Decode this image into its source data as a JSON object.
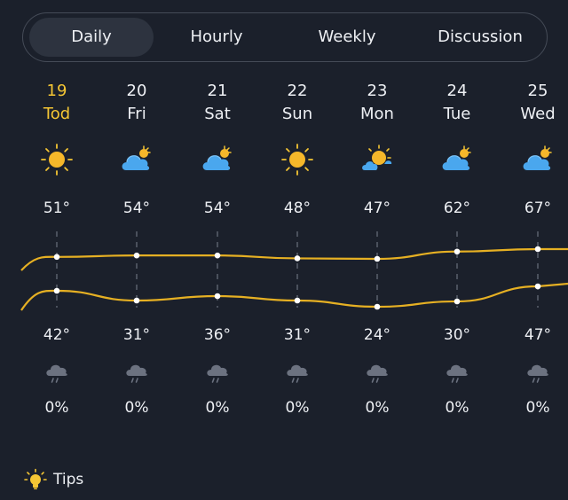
{
  "tabs": [
    {
      "label": "Daily",
      "active": true
    },
    {
      "label": "Hourly",
      "active": false
    },
    {
      "label": "Weekly",
      "active": false
    },
    {
      "label": "Discussion",
      "active": false
    }
  ],
  "days": [
    {
      "date": "19",
      "dow": "Tod",
      "icon": "sun-icon",
      "high": "51°",
      "low": "42°",
      "precip_icon": "rain-cloud-icon",
      "precip": "0%",
      "today": true
    },
    {
      "date": "20",
      "dow": "Fri",
      "icon": "cloud-sun-icon",
      "high": "54°",
      "low": "31°",
      "precip_icon": "rain-cloud-icon",
      "precip": "0%"
    },
    {
      "date": "21",
      "dow": "Sat",
      "icon": "cloud-sun-icon",
      "high": "54°",
      "low": "36°",
      "precip_icon": "rain-cloud-icon",
      "precip": "0%"
    },
    {
      "date": "22",
      "dow": "Sun",
      "icon": "sun-icon",
      "high": "48°",
      "low": "31°",
      "precip_icon": "rain-cloud-icon",
      "precip": "0%"
    },
    {
      "date": "23",
      "dow": "Mon",
      "icon": "sun-cloud-icon",
      "high": "47°",
      "low": "24°",
      "precip_icon": "rain-cloud-icon",
      "precip": "0%"
    },
    {
      "date": "24",
      "dow": "Tue",
      "icon": "cloud-sun-icon",
      "high": "62°",
      "low": "30°",
      "precip_icon": "rain-cloud-icon",
      "precip": "0%"
    },
    {
      "date": "25",
      "dow": "Wed",
      "icon": "cloud-sun-icon",
      "high": "67°",
      "low": "47°",
      "precip_icon": "rain-cloud-icon",
      "precip": "0%"
    }
  ],
  "tips": {
    "label": "Tips",
    "icon": "lightbulb-icon"
  },
  "colors": {
    "accent": "#f5c634",
    "background": "#1b202b",
    "line": "#e6b023"
  }
}
